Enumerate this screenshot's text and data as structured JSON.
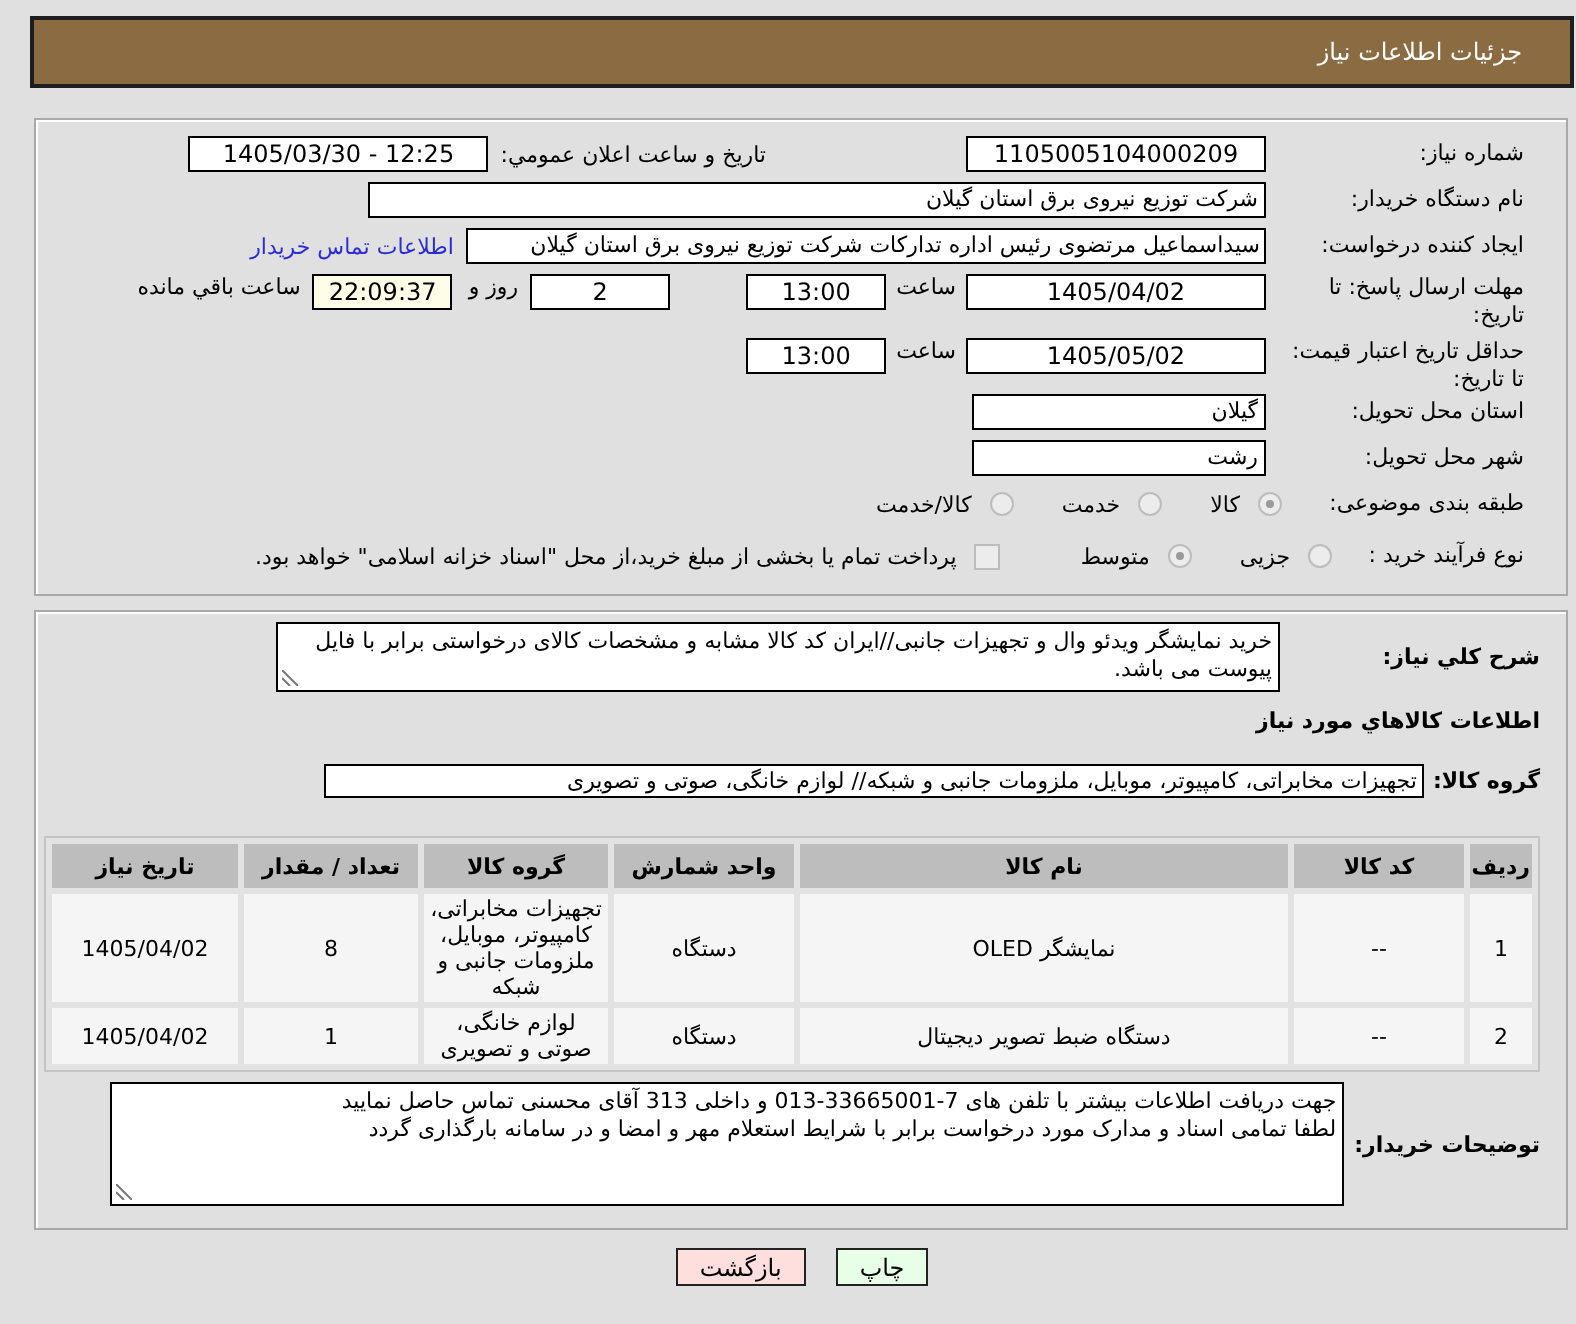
{
  "window": {
    "title": "جزئیات اطلاعات نیاز"
  },
  "need_details": {
    "need_number": {
      "label": "شماره نیاز:",
      "value": "1105005104000209"
    },
    "announce_datetime": {
      "label": "تاریخ و ساعت اعلان عمومي:",
      "value": "1405/03/30 - 12:25"
    },
    "buyer_org": {
      "label": "نام دستگاه خریدار:",
      "value": "شرکت توزیع نیروی برق استان گیلان"
    },
    "requester": {
      "label": "ایجاد کننده درخواست:",
      "value": "سیداسماعیل مرتضوی رئیس اداره تدارکات شرکت توزیع نیروی برق استان گیلان",
      "link": "اطلاعات تماس خریدار"
    },
    "response_deadline": {
      "label": "مهلت ارسال پاسخ: تا تاریخ:",
      "date": "1405/04/02",
      "time_label": "ساعت",
      "time": "13:00",
      "days": "2",
      "days_label": "روز و",
      "remaining_time": "22:09:37",
      "remaining_label": "ساعت باقي مانده"
    },
    "price_validity": {
      "label": "حداقل تاریخ اعتبار قیمت: تا تاریخ:",
      "date": "1405/05/02",
      "time_label": "ساعت",
      "time": "13:00"
    },
    "delivery_province": {
      "label": "استان محل تحویل:",
      "value": "گیلان"
    },
    "delivery_city": {
      "label": "شهر محل تحویل:",
      "value": "رشت"
    },
    "subject_category": {
      "label": "طبقه بندی موضوعی:",
      "options": [
        {
          "label": "کالا",
          "selected": true,
          "disabled": true
        },
        {
          "label": "خدمت",
          "selected": false,
          "disabled": true
        },
        {
          "label": "کالا/خدمت",
          "selected": false,
          "disabled": true
        }
      ]
    },
    "purchase_process": {
      "label": "نوع فرآیند خرید :",
      "options": [
        {
          "label": "جزیی",
          "selected": false,
          "disabled": true
        },
        {
          "label": "متوسط",
          "selected": true,
          "disabled": true
        }
      ],
      "treasury_payment": {
        "label": "پرداخت تمام یا بخشی از مبلغ خرید،از محل \"اسناد خزانه اسلامی\" خواهد بود.",
        "checked": false,
        "disabled": true
      }
    }
  },
  "goods_info": {
    "description": {
      "label": "شرح کلي نیاز:",
      "value": "خرید نمایشگر ویدئو وال و تجهیزات جانبی//ایران کد کالا مشابه و مشخصات کالای درخواستی برابر با فایل پیوست می باشد."
    },
    "section_title": "اطلاعات کالاهاي مورد نیاز",
    "goods_group": {
      "label": "گروه کالا:",
      "value": "تجهیزات مخابراتی، کامپیوتر، موبایل، ملزومات جانبی و شبکه// لوازم خانگی، صوتی و تصویری"
    },
    "table": {
      "columns": [
        "ردیف",
        "کد کالا",
        "نام کالا",
        "واحد شمارش",
        "گروه کالا",
        "تعداد / مقدار",
        "تاریخ نیاز"
      ],
      "rows": [
        [
          "1",
          "--",
          "نمایشگر OLED",
          "دستگاه",
          "تجهیزات مخابراتی، کامپیوتر، موبایل، ملزومات جانبی و شبکه",
          "8",
          "1405/04/02"
        ],
        [
          "2",
          "--",
          "دستگاه ضبط تصویر دیجیتال",
          "دستگاه",
          "لوازم خانگی، صوتی و تصویری",
          "1",
          "1405/04/02"
        ]
      ]
    },
    "buyer_notes": {
      "label": "توضیحات خریدار:",
      "lines": [
        "جهت دریافت اطلاعات بیشتر با تلفن های 7-33665001-013 و داخلی 313 آقای محسنی تماس حاصل نمایید",
        "لطفا تمامی اسناد و مدارک مورد درخواست برابر با شرایط استعلام مهر و امضا و در سامانه بارگذاری گردد"
      ]
    }
  },
  "buttons": [
    {
      "label": "چاپ",
      "color": "#e6ffe6"
    },
    {
      "label": "بازگشت",
      "color": "#ffdede"
    }
  ]
}
